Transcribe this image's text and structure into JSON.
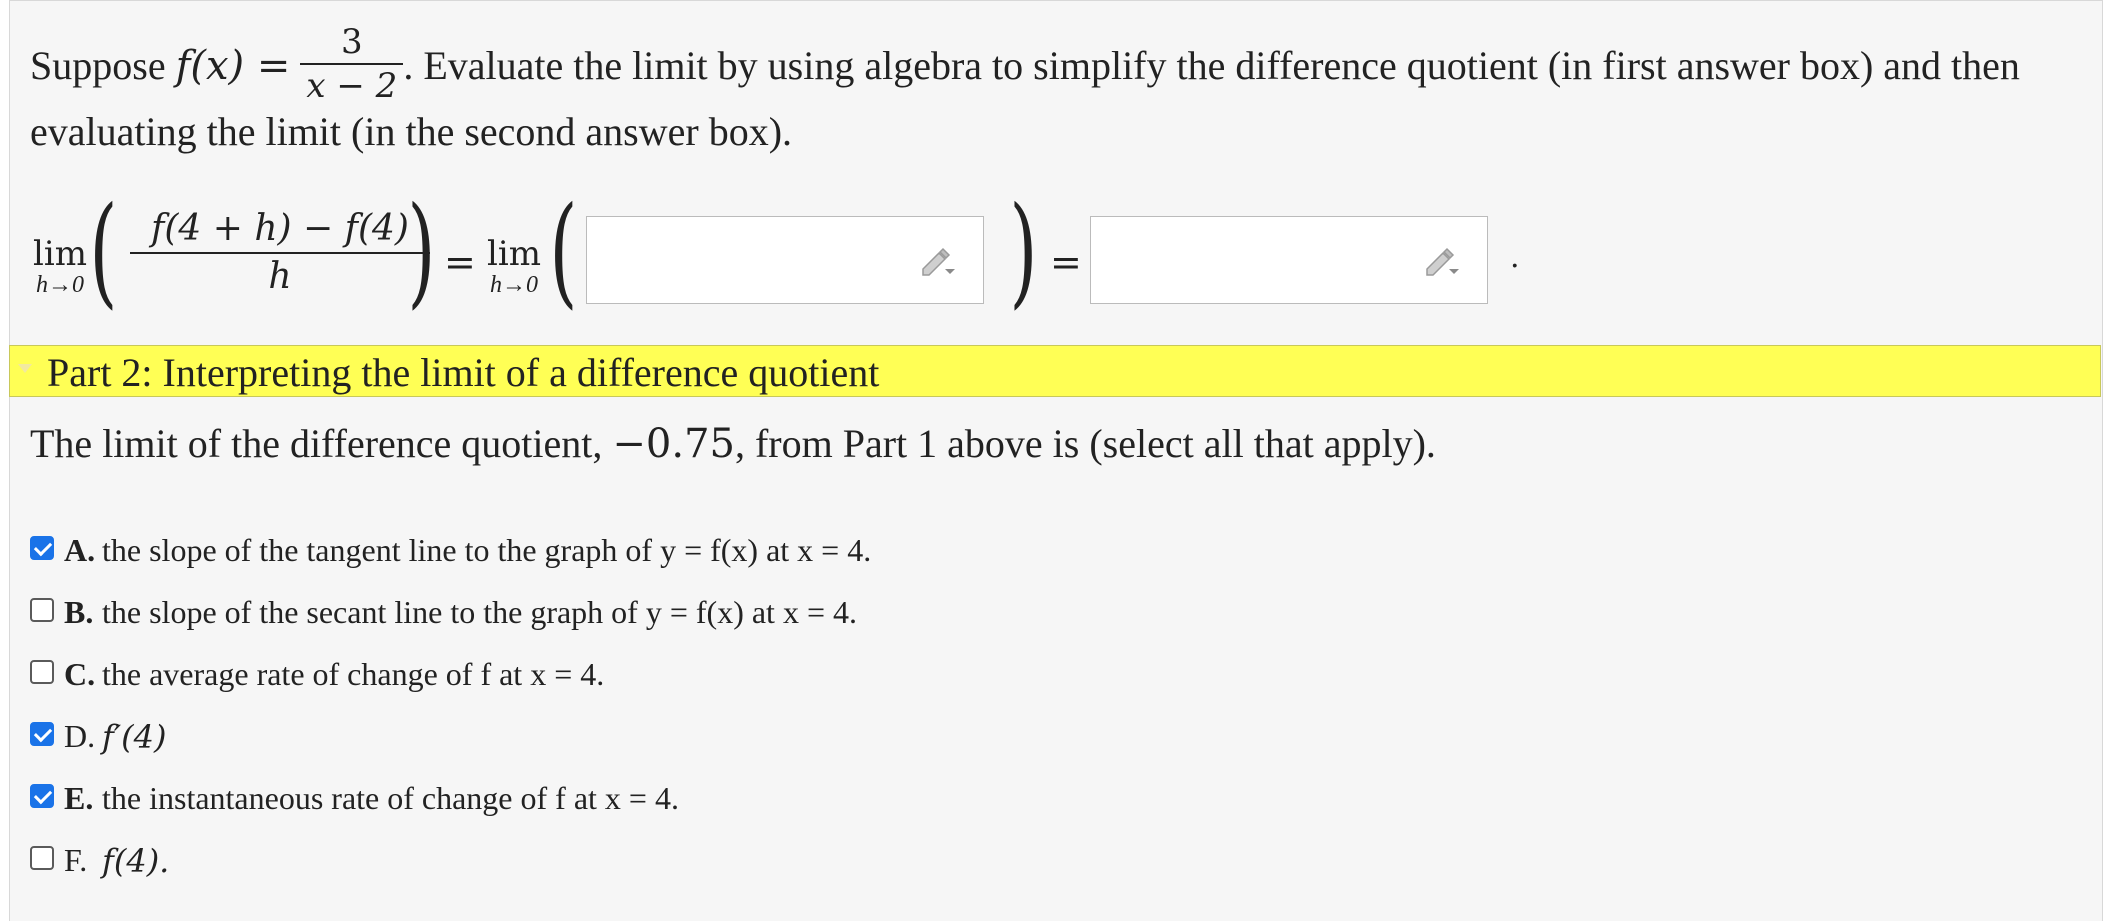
{
  "part1": {
    "intro_prefix": "Suppose ",
    "f_of_x": "f(x) =",
    "fraction_numerator": "3",
    "fraction_denominator": "x − 2",
    "intro_suffix": ". Evaluate the limit by using algebra to simplify the difference quotient (in first answer box) and then",
    "intro_line2": "evaluating the limit (in the second answer box).",
    "lim_word": "lim",
    "lim_sub": "h→0",
    "dq_numerator": "f(4 + h) − f(4)",
    "dq_denominator": "h",
    "equals": "=",
    "answer_box_1_value": "",
    "answer_box_2_value": "",
    "trailing_period": "."
  },
  "part2": {
    "header_title": "Part 2: Interpreting the limit of a difference quotient",
    "question_prefix": "The limit of the difference quotient, ",
    "question_value": "−0.75",
    "question_suffix": ", from Part 1 above is (select all that apply).",
    "options": [
      {
        "letter": "A.",
        "text": "the slope of the tangent line to the graph of y = f(x) at x = 4.",
        "checked": true
      },
      {
        "letter": "B.",
        "text": "the slope of the secant line to the graph of y = f(x) at x = 4.",
        "checked": false
      },
      {
        "letter": "C.",
        "text": "the average rate of change of f at x = 4.",
        "checked": false
      },
      {
        "letter": "D.",
        "text": "f′(4)",
        "checked": true
      },
      {
        "letter": "E.",
        "text": "the instantaneous rate of change of f at x = 4.",
        "checked": true
      },
      {
        "letter": "F.",
        "text": "f(4).",
        "checked": false
      }
    ]
  },
  "colors": {
    "header_bg": "#ffff55",
    "checkbox_checked": "#1a73e8",
    "panel_bg": "#f6f6f6"
  }
}
